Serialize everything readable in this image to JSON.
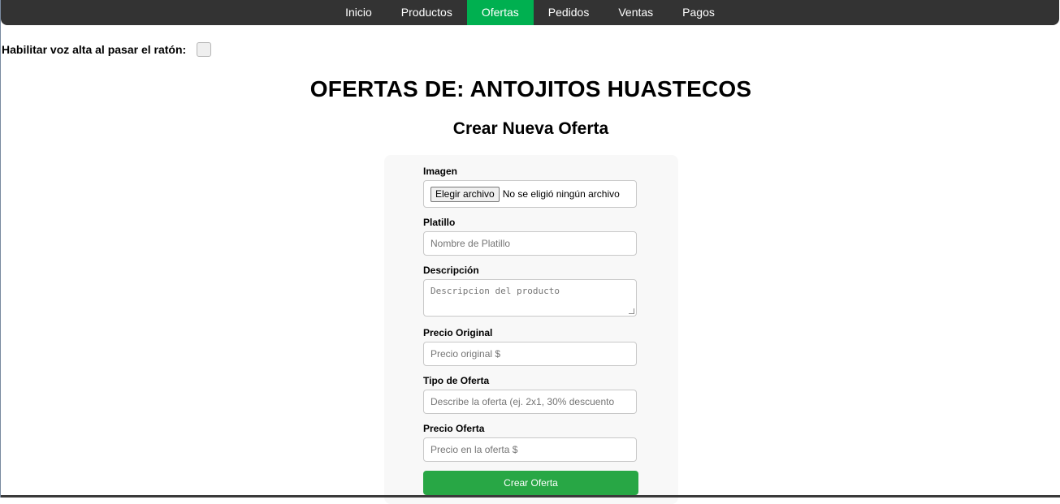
{
  "nav": {
    "items": [
      {
        "label": "Inicio"
      },
      {
        "label": "Productos"
      },
      {
        "label": "Ofertas",
        "active": true
      },
      {
        "label": "Pedidos"
      },
      {
        "label": "Ventas"
      },
      {
        "label": "Pagos"
      }
    ],
    "active_color": "#00b050",
    "bar_color": "#333333"
  },
  "voice": {
    "label": "Habilitar voz alta al pasar el ratón:",
    "checked": false
  },
  "page_title": "OFERTAS DE: ANTOJITOS HUASTECOS",
  "form": {
    "title": "Crear Nueva Oferta",
    "image_label": "Imagen",
    "file_button": "Elegir archivo",
    "file_status": "No se eligió ningún archivo",
    "dish_label": "Platillo",
    "dish_placeholder": "Nombre de Platillo",
    "description_label": "Descripción",
    "description_placeholder": "Descripcion del producto",
    "original_price_label": "Precio Original",
    "original_price_placeholder": "Precio original $",
    "offer_type_label": "Tipo de Oferta",
    "offer_type_placeholder": "Describe la oferta (ej. 2x1, 30% descuento",
    "offer_price_label": "Precio Oferta",
    "offer_price_placeholder": "Precio en la oferta $",
    "submit_label": "Crear Oferta",
    "submit_color": "#28a745"
  }
}
